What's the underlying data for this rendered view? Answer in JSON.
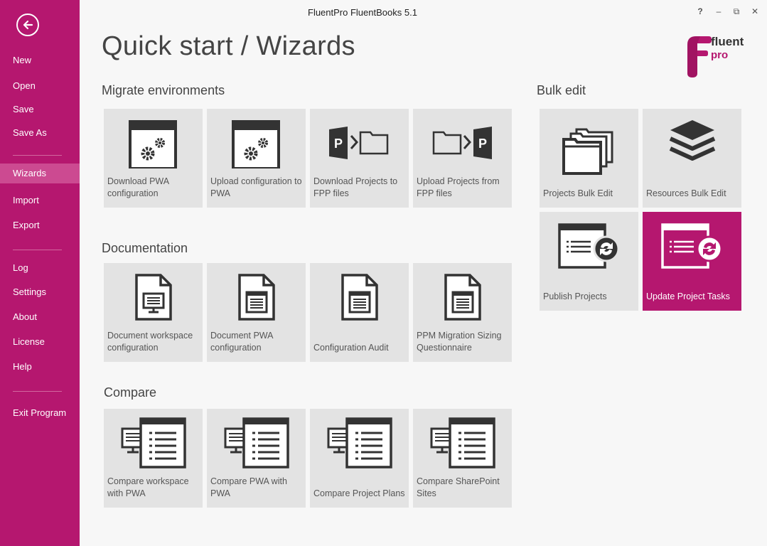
{
  "window": {
    "title": "FluentPro FluentBooks 5.1",
    "controls": {
      "help": "?",
      "minimize": "–",
      "restore": "⧉",
      "close": "✕"
    }
  },
  "sidebar": {
    "items": [
      {
        "label": "New"
      },
      {
        "label": "Open"
      },
      {
        "label": "Save"
      },
      {
        "label": "Save As"
      },
      {
        "label": "Wizards",
        "active": true
      },
      {
        "label": "Import"
      },
      {
        "label": "Export"
      },
      {
        "label": "Log"
      },
      {
        "label": "Settings"
      },
      {
        "label": "About"
      },
      {
        "label": "License"
      },
      {
        "label": "Help"
      },
      {
        "label": "Exit Program"
      }
    ]
  },
  "page": {
    "title": "Quick start / Wizards"
  },
  "logo": {
    "line1": "fluent",
    "line2": "pro"
  },
  "sections": {
    "migrate": {
      "title": "Migrate environments",
      "tiles": [
        {
          "label": "Download PWA configuration",
          "icon": "gears-window-icon"
        },
        {
          "label": "Upload configuration to PWA",
          "icon": "gears-window-icon"
        },
        {
          "label": "Download Projects to FPP files",
          "icon": "project-to-folder-icon"
        },
        {
          "label": "Upload Projects from FPP files",
          "icon": "folder-to-project-icon"
        }
      ]
    },
    "documentation": {
      "title": "Documentation",
      "tiles": [
        {
          "label": "Document workspace configuration",
          "icon": "document-monitor-icon"
        },
        {
          "label": "Document PWA configuration",
          "icon": "document-list-icon"
        },
        {
          "label": "Configuration Audit",
          "icon": "document-list-icon"
        },
        {
          "label": "PPM Migration Sizing Questionnaire",
          "icon": "document-list-icon"
        }
      ]
    },
    "compare": {
      "title": "Compare",
      "tiles": [
        {
          "label": "Compare workspace with PWA",
          "icon": "compare-icon"
        },
        {
          "label": "Compare PWA with PWA",
          "icon": "compare-icon"
        },
        {
          "label": "Compare Project Plans",
          "icon": "compare-icon"
        },
        {
          "label": "Compare SharePoint Sites",
          "icon": "compare-icon"
        }
      ]
    },
    "bulk": {
      "title": "Bulk edit",
      "tiles": [
        {
          "label": "Projects Bulk Edit",
          "icon": "stacked-folders-icon"
        },
        {
          "label": "Resources Bulk Edit",
          "icon": "layers-icon"
        },
        {
          "label": "Publish Projects",
          "icon": "publish-sync-icon"
        },
        {
          "label": "Update Project Tasks",
          "icon": "update-sync-icon",
          "active": true
        }
      ]
    }
  },
  "colors": {
    "accent": "#b5176f",
    "accent_light": "#cc4a91",
    "tile": "#e3e3e3",
    "icon": "#333333"
  }
}
